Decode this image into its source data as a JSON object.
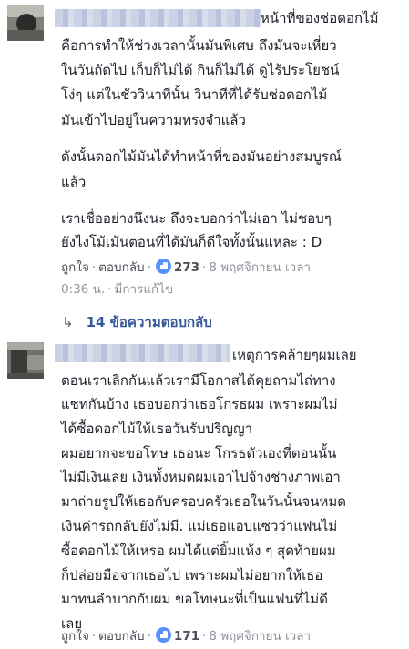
{
  "comments": [
    {
      "lines": [
        "หน้าที่ของช่อดอกไม้",
        "คือการทำให้ช่วงเวลานั้นมันพิเศษ ถึงมันจะเหี่ยว",
        "ในวันถัดไป เก็บก็ไม่ได้ กินก็ไม่ได้ ดูไร้ประโยชน์",
        "โง่ๆ แต่ในชั่ววินาทีนั้น วินาทีที่ได้รับช่อดอกไม้",
        "มันเข้าไปอยู่ในความทรงจำแล้ว",
        "ดังนั้นดอกไม้มันได้ทำหน้าที่ของมันอย่างสมบูรณ์",
        "แล้ว",
        "เราเชื่ออย่างนึงนะ ถึงจะบอกว่าไม่เอา ไม่ชอบๆ",
        "ยังไงโม้เม้นตอนที่ได้มันก็ดีใจทั้งนั้นแหละ : D"
      ],
      "actions": {
        "like": "ถูกใจ",
        "reply": "ตอบกลับ",
        "like_count": "273",
        "time": "8 พฤศจิกายน เวลา",
        "time_cont": "0:36 น.",
        "edited": "มีการแก้ไข"
      },
      "replies_label": "14 ข้อความตอบกลับ"
    },
    {
      "lines": [
        "เหตุการคล้ายๆผมเลย",
        "ตอนเราเลิกกันแล้วเรามีโอกาสได้คุยถามไถ่ทาง",
        "แชทกันบ้าง เธอบอกว่าเธอโกรธผม เพราะผมไม่",
        "ได้ซื้อดอกไม้ให้เธอวันรับปริญญา",
        "ผมอยากจะขอโทษ เธอนะ โกรธตัวเองที่ตอนนั้น",
        "ไม่มีเงินเลย เงินทั้งหมดผมเอาไปจ้างช่างภาพเอา",
        "มาถ่ายรูปให้เธอกับครอบครัวเธอในวันนั้นจนหมด",
        "เงินค่ารถกลับยังไม่มี. แม่เธอแอบแซวว่าแฟนไม่",
        "ซื้อดอกไม้ให้เหรอ ผมได้แต่ยิ้มแห้ง ๆ สุดท้ายผม",
        "ก็ปล่อยมือจากเธอไป เพราะผมไม่อยากให้เธอ",
        "มาทนลำบากกับผม ขอโทษนะที่เป็นแฟนที่ไม่ดี",
        "เลย"
      ],
      "actions": {
        "like": "ถูกใจ",
        "reply": "ตอบกลับ",
        "like_count": "171",
        "time": "8 พฤศจิกายน เวลา"
      }
    }
  ],
  "colors": {
    "text": "#1d2129",
    "meta": "#90949c",
    "link": "#365899",
    "like": "#5890ff"
  }
}
